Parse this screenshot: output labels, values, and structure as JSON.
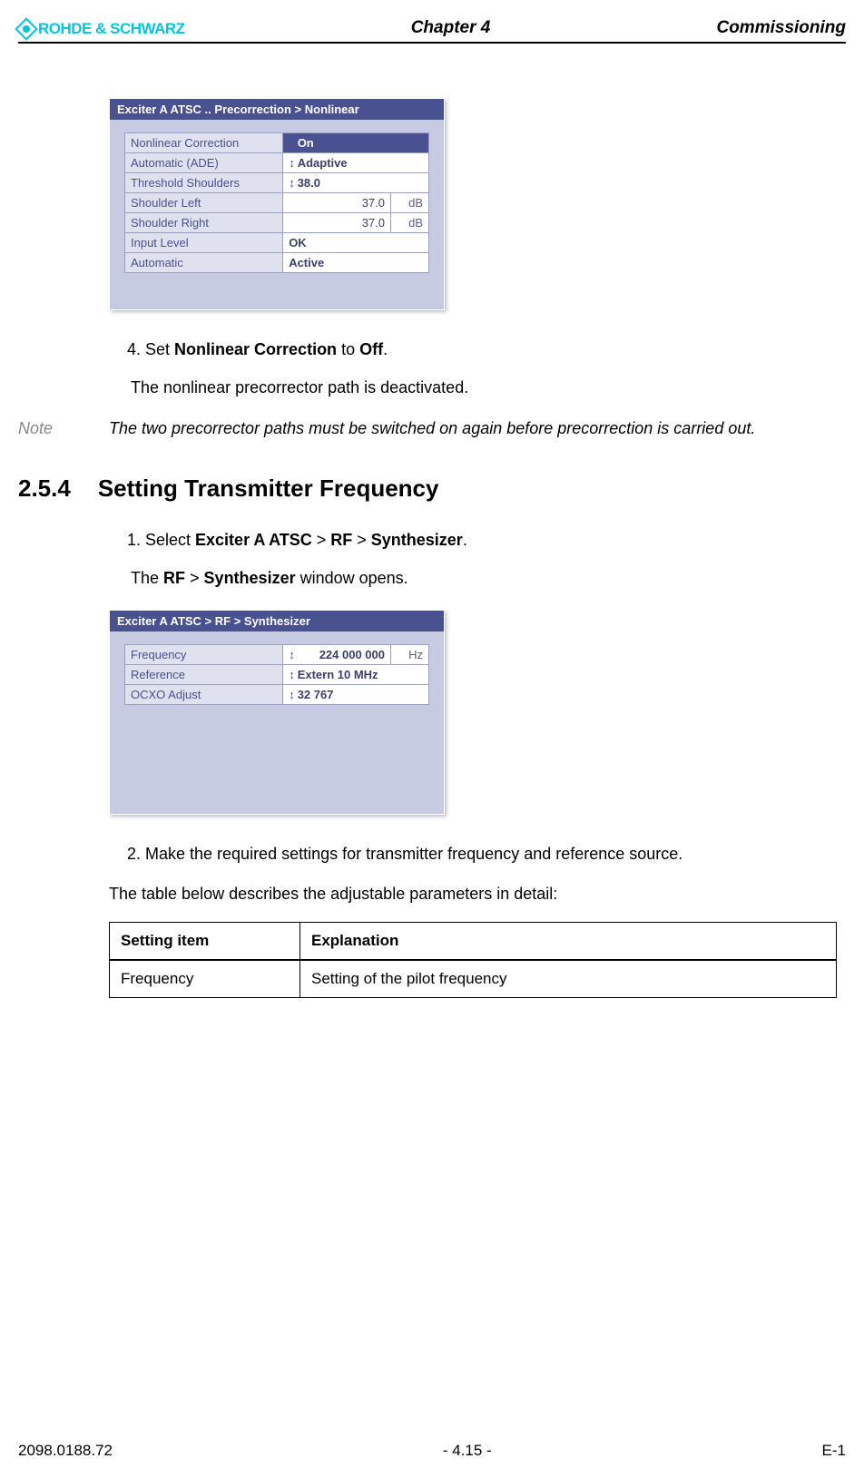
{
  "header": {
    "brand": "ROHDE & SCHWARZ",
    "chapter": "Chapter 4",
    "right": "Commissioning"
  },
  "window1": {
    "title": "Exciter A ATSC .. Precorrection > Nonlinear",
    "rows": [
      {
        "label": "Nonlinear Correction",
        "value": "On",
        "spin": true,
        "highlight": true
      },
      {
        "label": "Automatic (ADE)",
        "value": "Adaptive",
        "spin": true
      },
      {
        "label": "Threshold Shoulders",
        "value": "38.0",
        "spin": true
      },
      {
        "label": "Shoulder Left",
        "value": "37.0",
        "unit": "dB"
      },
      {
        "label": "Shoulder Right",
        "value": "37.0",
        "unit": "dB"
      },
      {
        "label": "Input Level",
        "value": "OK"
      },
      {
        "label": "Automatic",
        "value": "Active"
      }
    ]
  },
  "step4": {
    "num": "4.",
    "text1": "Set ",
    "b1": "Nonlinear Correction",
    "text2": " to ",
    "b2": "Off",
    "text3": ".",
    "follow": "The nonlinear precorrector path is deactivated."
  },
  "note": {
    "label": "Note",
    "text": "The two precorrector paths must be switched on again before precorrection is carried out."
  },
  "section": {
    "num": "2.5.4",
    "title": "Setting Transmitter Frequency"
  },
  "step1b": {
    "num": "1.",
    "text1": "Select ",
    "b1": "Exciter A ATSC",
    "gt1": " > ",
    "b2": "RF",
    "gt2": " > ",
    "b3": "Synthesizer",
    "end": ".",
    "follow1": "The ",
    "fb1": "RF",
    "fgt": " > ",
    "fb2": "Synthesizer",
    "follow2": " window opens."
  },
  "window2": {
    "title": "Exciter A ATSC  > RF > Synthesizer",
    "rows": [
      {
        "label": "Frequency",
        "value": "224 000 000",
        "unit": "Hz",
        "spin": true
      },
      {
        "label": "Reference",
        "value": "Extern 10 MHz",
        "spin": true
      },
      {
        "label": "OCXO Adjust",
        "value": "32 767",
        "spin": true
      }
    ]
  },
  "step2b": {
    "num": "2.",
    "text": "Make the required settings for transmitter frequency and reference source."
  },
  "tableIntro": "The table below describes the adjustable parameters in detail:",
  "paramTable": {
    "h1": "Setting item",
    "h2": "Explanation",
    "r1c1": "Frequency",
    "r1c2": "Setting of the pilot frequency"
  },
  "footer": {
    "left": "2098.0188.72",
    "center": "- 4.15 -",
    "right": "E-1"
  }
}
